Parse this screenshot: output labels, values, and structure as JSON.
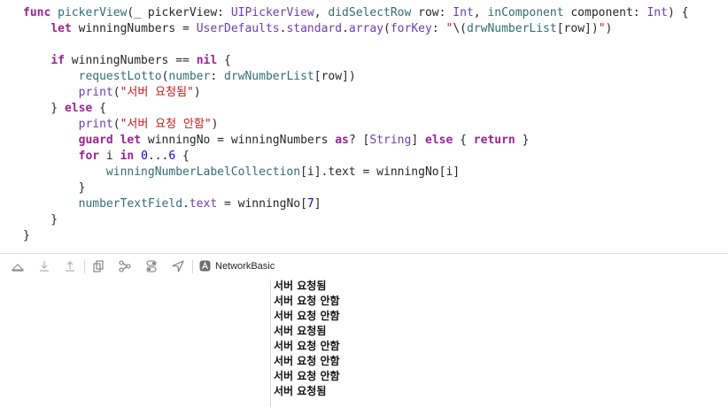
{
  "editor": {
    "lines": [
      [
        {
          "t": "func",
          "c": "kw"
        },
        {
          "t": " ",
          "c": "pl"
        },
        {
          "t": "pickerView",
          "c": "fn"
        },
        {
          "t": "(_ pickerView: ",
          "c": "pl"
        },
        {
          "t": "UIPickerView",
          "c": "ty"
        },
        {
          "t": ", ",
          "c": "pl"
        },
        {
          "t": "didSelectRow",
          "c": "fn"
        },
        {
          "t": " row: ",
          "c": "pl"
        },
        {
          "t": "Int",
          "c": "ty"
        },
        {
          "t": ", ",
          "c": "pl"
        },
        {
          "t": "inComponent",
          "c": "fn"
        },
        {
          "t": " component: ",
          "c": "pl"
        },
        {
          "t": "Int",
          "c": "ty"
        },
        {
          "t": ") {",
          "c": "pl"
        }
      ],
      [
        {
          "t": "    ",
          "c": "pl"
        },
        {
          "t": "let",
          "c": "kw"
        },
        {
          "t": " winningNumbers = ",
          "c": "pl"
        },
        {
          "t": "UserDefaults",
          "c": "ty"
        },
        {
          "t": ".",
          "c": "pl"
        },
        {
          "t": "standard",
          "c": "ty"
        },
        {
          "t": ".",
          "c": "pl"
        },
        {
          "t": "array",
          "c": "ty"
        },
        {
          "t": "(",
          "c": "pl"
        },
        {
          "t": "forKey",
          "c": "ty"
        },
        {
          "t": ": ",
          "c": "pl"
        },
        {
          "t": "\"",
          "c": "str"
        },
        {
          "t": "\\(",
          "c": "esc"
        },
        {
          "t": "drwNumberList",
          "c": "fn"
        },
        {
          "t": "[row])",
          "c": "pl"
        },
        {
          "t": "\"",
          "c": "str"
        },
        {
          "t": ")",
          "c": "pl"
        }
      ],
      [],
      [
        {
          "t": "    ",
          "c": "pl"
        },
        {
          "t": "if",
          "c": "kw"
        },
        {
          "t": " winningNumbers == ",
          "c": "pl"
        },
        {
          "t": "nil",
          "c": "kw"
        },
        {
          "t": " {",
          "c": "pl"
        }
      ],
      [
        {
          "t": "        ",
          "c": "pl"
        },
        {
          "t": "requestLotto",
          "c": "fn"
        },
        {
          "t": "(",
          "c": "pl"
        },
        {
          "t": "number",
          "c": "fn"
        },
        {
          "t": ": ",
          "c": "pl"
        },
        {
          "t": "drwNumberList",
          "c": "fn"
        },
        {
          "t": "[row])",
          "c": "pl"
        }
      ],
      [
        {
          "t": "        ",
          "c": "pl"
        },
        {
          "t": "print",
          "c": "ty"
        },
        {
          "t": "(",
          "c": "pl"
        },
        {
          "t": "\"서버 요청됨\"",
          "c": "str"
        },
        {
          "t": ")",
          "c": "pl"
        }
      ],
      [
        {
          "t": "    } ",
          "c": "pl"
        },
        {
          "t": "else",
          "c": "kw"
        },
        {
          "t": " {",
          "c": "pl"
        }
      ],
      [
        {
          "t": "        ",
          "c": "pl"
        },
        {
          "t": "print",
          "c": "ty"
        },
        {
          "t": "(",
          "c": "pl"
        },
        {
          "t": "\"서버 요청 안함\"",
          "c": "str"
        },
        {
          "t": ")",
          "c": "pl"
        }
      ],
      [
        {
          "t": "        ",
          "c": "pl"
        },
        {
          "t": "guard",
          "c": "kw"
        },
        {
          "t": " ",
          "c": "pl"
        },
        {
          "t": "let",
          "c": "kw"
        },
        {
          "t": " winningNo = winningNumbers ",
          "c": "pl"
        },
        {
          "t": "as",
          "c": "kw"
        },
        {
          "t": "? [",
          "c": "pl"
        },
        {
          "t": "String",
          "c": "ty"
        },
        {
          "t": "] ",
          "c": "pl"
        },
        {
          "t": "else",
          "c": "kw"
        },
        {
          "t": " { ",
          "c": "pl"
        },
        {
          "t": "return",
          "c": "kw"
        },
        {
          "t": " }",
          "c": "pl"
        }
      ],
      [
        {
          "t": "        ",
          "c": "pl"
        },
        {
          "t": "for",
          "c": "kw"
        },
        {
          "t": " i ",
          "c": "pl"
        },
        {
          "t": "in",
          "c": "kw"
        },
        {
          "t": " ",
          "c": "pl"
        },
        {
          "t": "0",
          "c": "num"
        },
        {
          "t": "...",
          "c": "pl"
        },
        {
          "t": "6",
          "c": "num"
        },
        {
          "t": " {",
          "c": "pl"
        }
      ],
      [
        {
          "t": "            ",
          "c": "pl"
        },
        {
          "t": "winningNumberLabelCollection",
          "c": "fn"
        },
        {
          "t": "[i].text = winningNo[i]",
          "c": "pl"
        }
      ],
      [
        {
          "t": "        }",
          "c": "pl"
        }
      ],
      [
        {
          "t": "        ",
          "c": "pl"
        },
        {
          "t": "numberTextField",
          "c": "fn"
        },
        {
          "t": ".",
          "c": "pl"
        },
        {
          "t": "text",
          "c": "ty"
        },
        {
          "t": " = winningNo[",
          "c": "pl"
        },
        {
          "t": "7",
          "c": "num"
        },
        {
          "t": "]",
          "c": "pl"
        }
      ],
      [
        {
          "t": "    }",
          "c": "pl"
        }
      ],
      [
        {
          "t": "}",
          "c": "pl"
        }
      ]
    ]
  },
  "debug_bar": {
    "target_name": "NetworkBasic",
    "icons": [
      "hide-debug-area-icon",
      "step-over-icon",
      "step-into-icon",
      "step-out-icon",
      "view-hierarchy-icon",
      "memory-graph-icon",
      "environment-overrides-icon",
      "simulate-location-icon",
      "app-target-icon"
    ]
  },
  "console": {
    "lines": [
      "서버 요청됨",
      "서버 요청 안함",
      "서버 요청 안함",
      "서버 요청됨",
      "서버 요청 안함",
      "서버 요청 안함",
      "서버 요청 안함",
      "서버 요청됨"
    ]
  }
}
